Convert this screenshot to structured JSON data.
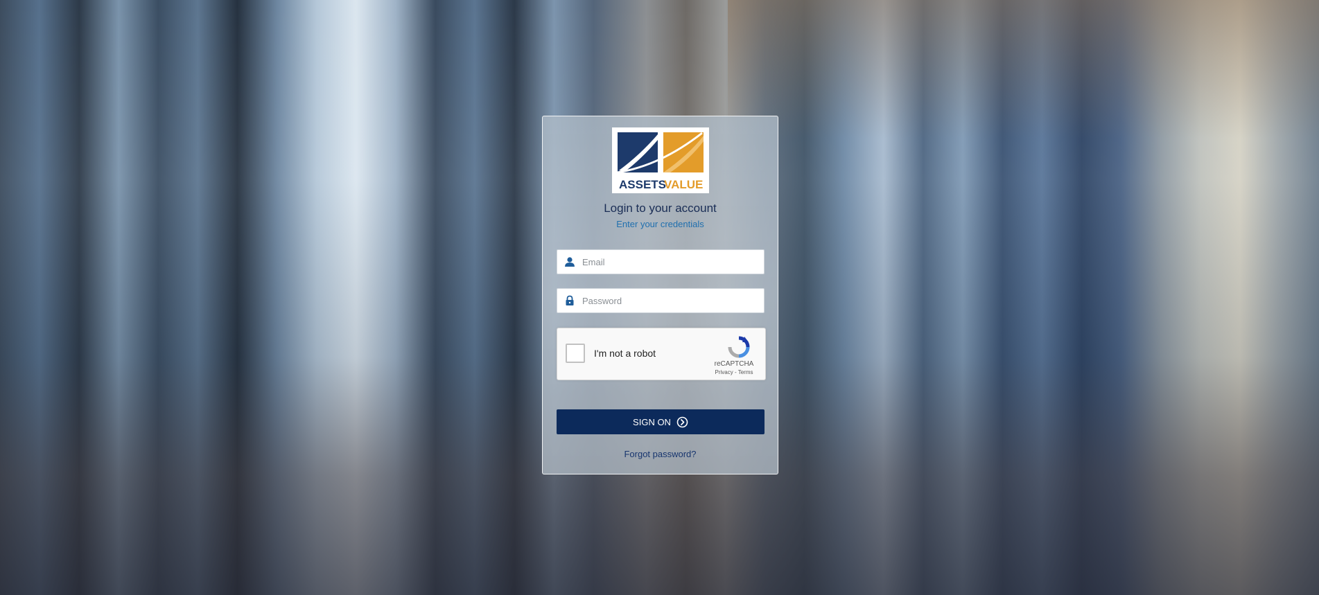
{
  "brand": {
    "logo_word_1": "ASSETS",
    "logo_word_2": "VALUE",
    "colors": {
      "navy": "#1d3a6b",
      "orange": "#e39c2a",
      "button": "#0c2a5b"
    }
  },
  "login": {
    "title": "Login to your account",
    "subtitle": "Enter your credentials",
    "email": {
      "icon": "user-icon",
      "placeholder": "Email",
      "value": ""
    },
    "password": {
      "icon": "lock-icon",
      "placeholder": "Password",
      "value": ""
    },
    "captcha": {
      "label": "I'm not a robot",
      "brand": "reCAPTCHA",
      "privacy": "Privacy",
      "separator": " - ",
      "terms": "Terms",
      "checked": false
    },
    "submit": {
      "label": "SIGN ON",
      "icon": "circle-arrow-right-icon"
    },
    "forgot_password": "Forgot password?"
  }
}
